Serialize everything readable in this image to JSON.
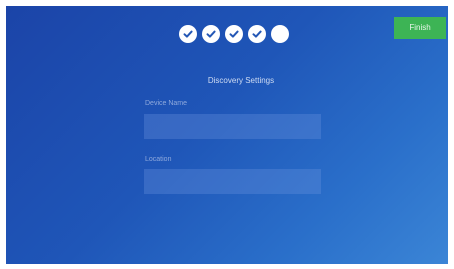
{
  "header": {
    "steps": [
      {
        "state": "complete",
        "icon": "check-icon"
      },
      {
        "state": "complete",
        "icon": "check-icon"
      },
      {
        "state": "complete",
        "icon": "check-icon"
      },
      {
        "state": "complete",
        "icon": "check-icon"
      },
      {
        "state": "current",
        "icon": "empty-circle-icon"
      }
    ],
    "finish_label": "Finish"
  },
  "form": {
    "title": "Discovery Settings",
    "device_name": {
      "label": "Device Name",
      "value": ""
    },
    "location": {
      "label": "Location",
      "value": ""
    }
  },
  "colors": {
    "background_start": "#1b44a8",
    "background_end": "#3b85d6",
    "finish_button": "#3db455"
  }
}
